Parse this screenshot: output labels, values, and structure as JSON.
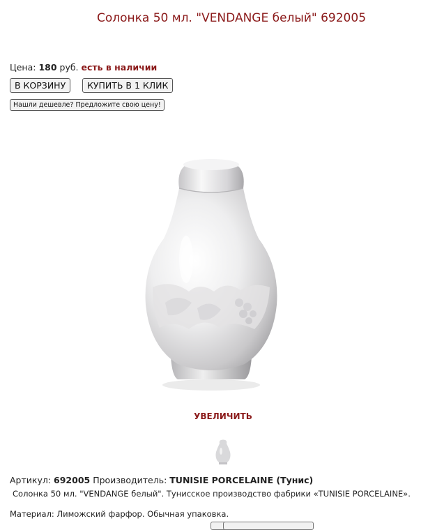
{
  "product": {
    "title": "Солонка 50 мл. \"VENDANGE белый\" 692005"
  },
  "price": {
    "label": "Цена:",
    "value": "180",
    "currency": "руб.",
    "stock": "есть в наличии"
  },
  "buttons": {
    "cart": "В КОРЗИНУ",
    "one_click": "КУПИТЬ В 1 КЛИК",
    "cheaper": "Нашли дешевле? Предложите свою цену!"
  },
  "image": {
    "zoom_label": "УВЕЛИЧИТЬ"
  },
  "details": {
    "sku_label": "Артикул:",
    "sku": "692005",
    "maker_label": "Производитель:",
    "maker": "TUNISIE PORCELAINE (Тунис)",
    "description": "Солонка 50 мл. \"VENDANGE белый\". Тунисское производство фабрики «TUNISIE PORCELAINE».",
    "material": "Материал: Лиможский фарфор. Обычная упаковка."
  },
  "colors": {
    "accent": "#8b1a1a",
    "text": "#222222",
    "button_bg": "#f2f2f2"
  }
}
